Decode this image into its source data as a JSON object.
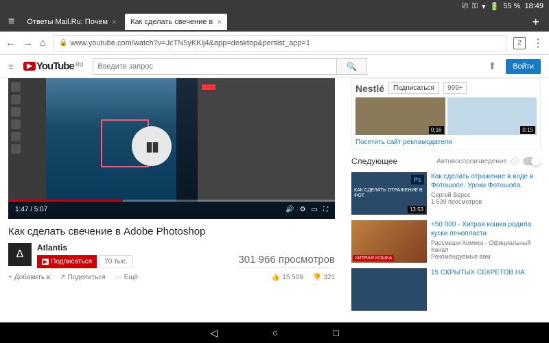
{
  "status": {
    "battery": "55 %",
    "time": "18:49"
  },
  "tabs": {
    "inactive": "Ответы Mail.Ru: Почем",
    "active": "Как сделать свечение в"
  },
  "url": "www.youtube.com/watch?v=JcTN5yKKij4&app=desktop&persist_app=1",
  "tab_count": "2",
  "yt": {
    "logo_text": "YouTube",
    "logo_ru": "RU",
    "search_placeholder": "Введите запрос",
    "signin": "Войти"
  },
  "video": {
    "time": "1:47 / 5:07",
    "title": "Как сделать свечение в Adobe Photoshop",
    "channel": "Atlantis",
    "channel_letter": "Δ",
    "subscribe": "Подписаться",
    "sub_count": "70 тыс.",
    "views": "301 966 просмотров",
    "add": "Добавить в",
    "share": "Поделиться",
    "more": "Ещё",
    "likes": "15 509",
    "dislikes": "321"
  },
  "ad": {
    "brand": "Nestlé",
    "subscribe": "Подписаться",
    "count": "999+",
    "dur1": "0:16",
    "dur2": "0:15",
    "link": "Посетить сайт рекламодателя"
  },
  "next": {
    "title": "Следующее",
    "auto": "Автовоспроизведение"
  },
  "recs": [
    {
      "title": "Как сделать отражение в воде в Фотошопе. Уроки Фотошопа.",
      "channel": "Сергей Верес",
      "views": "1 639 просмотров",
      "dur": "13:53",
      "overlay": "КАК СДЕЛАТЬ ОТРАЖЕНИЕ В ФОТ",
      "badge": "Ps"
    },
    {
      "title": "+50 000 - Хитрая кошка родила куски пенопласта",
      "channel": "Рассмеши Комика - Официальный Канал",
      "views": "Рекомендуемые вам",
      "label": "ХИТРАЯ КОШКА"
    },
    {
      "title": "15 СКРЫТЫХ СЕКРЕТОВ НА"
    }
  ]
}
